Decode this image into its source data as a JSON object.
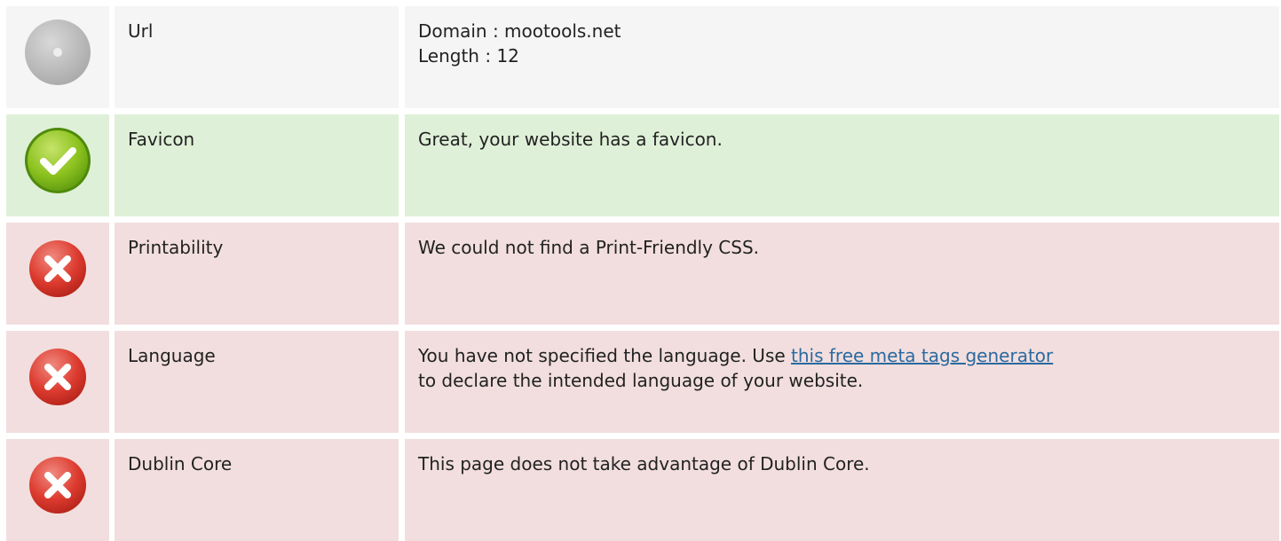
{
  "rows": [
    {
      "status": "neutral",
      "icon": "neutral-icon",
      "label": "Url",
      "lines": [
        "Domain : mootools.net",
        "Length : 12"
      ]
    },
    {
      "status": "good",
      "icon": "check-icon",
      "label": "Favicon",
      "lines": [
        "Great, your website has a favicon."
      ]
    },
    {
      "status": "bad",
      "icon": "error-icon",
      "label": "Printability",
      "lines": [
        "We could not find a Print-Friendly CSS."
      ]
    },
    {
      "status": "bad",
      "icon": "error-icon",
      "label": "Language",
      "text_before_link": "You have not specified the language. Use ",
      "link_text": "this free meta tags generator",
      "text_after_link": "to declare the intended language of your website."
    },
    {
      "status": "bad",
      "icon": "error-icon",
      "label": "Dublin Core",
      "lines": [
        "This page does not take advantage of Dublin Core."
      ]
    }
  ],
  "colors": {
    "neutral_bg": "#f5f5f5",
    "good_bg": "#dff0d8",
    "bad_bg": "#f2dede",
    "link": "#2a6aa0"
  }
}
